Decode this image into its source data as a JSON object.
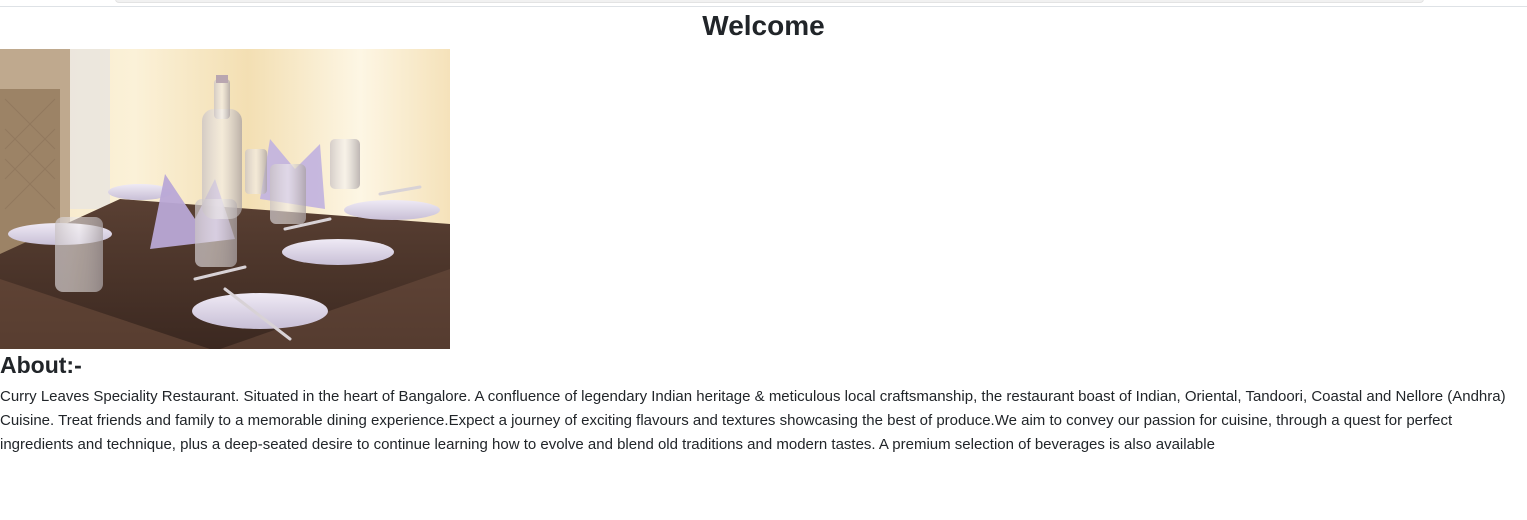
{
  "header": {
    "title": "Welcome"
  },
  "hero": {
    "alt": "Restaurant dining table set with plates, glasses and folded napkins"
  },
  "about": {
    "heading": "About:-",
    "text": "Curry Leaves Speciality Restaurant. Situated in the heart of Bangalore. A confluence of legendary Indian heritage & meticulous local craftsmanship, the restaurant boast of Indian, Oriental, Tandoori, Coastal and Nellore (Andhra) Cuisine. Treat friends and family to a memorable dining experience.Expect a journey of exciting flavours and textures showcasing the best of produce.We aim to convey our passion for cuisine, through a quest for perfect ingredients and technique, plus a deep-seated desire to continue learning how to evolve and blend old traditions and modern tastes. A premium selection of beverages is also available"
  }
}
